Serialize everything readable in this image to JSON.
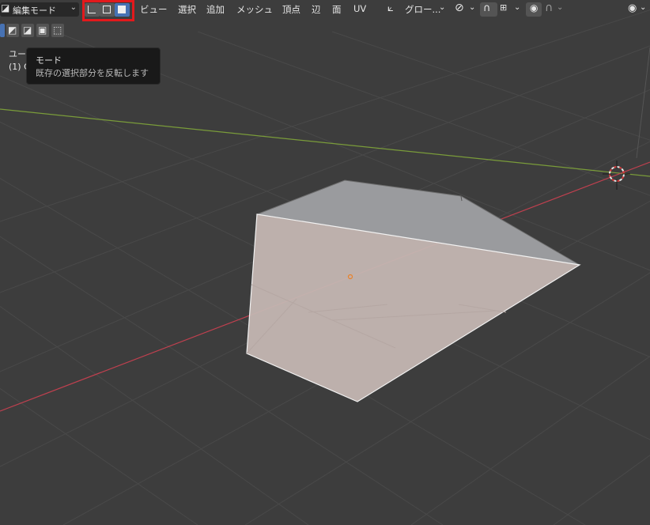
{
  "header": {
    "mode_select": {
      "label": "編集モード",
      "icon": "cube-edit-icon"
    },
    "menus": [
      "ビュー",
      "選択",
      "追加",
      "メッシュ",
      "頂点",
      "辺",
      "面",
      "UV"
    ],
    "transform_orientation": "グロー..."
  },
  "select_mode_buttons": [
    {
      "name": "vertex-select",
      "icon": "vertex-select-icon",
      "active": false
    },
    {
      "name": "edge-select",
      "icon": "edge-select-icon",
      "active": false
    },
    {
      "name": "face-select",
      "icon": "face-select-icon",
      "active": true
    }
  ],
  "overlay": {
    "line1": "ユー",
    "line2": "(1) C"
  },
  "tooltip": {
    "title": "モード",
    "description": "既存の選択部分を反転します"
  },
  "colors": {
    "viewport_bg": "#3d3d3d",
    "grid": "#494949",
    "x_axis": "#c0404f",
    "y_axis": "#7a9c3a",
    "face_selected": "#c4b6b2",
    "top_face": "#9a9b9e",
    "highlight_box": "#e3191c",
    "active_blue": "#4772b3"
  }
}
